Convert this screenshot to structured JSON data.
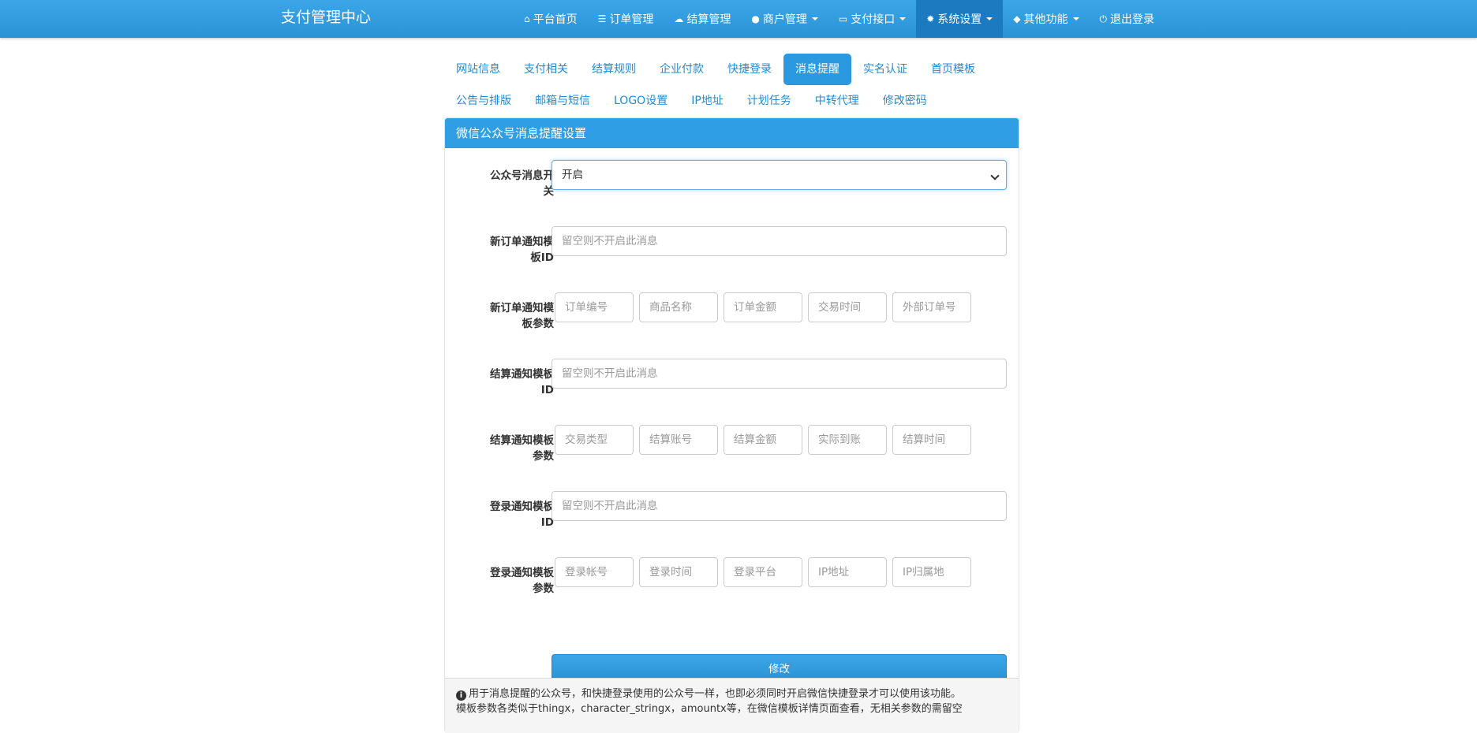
{
  "app": {
    "title": "支付管理中心"
  },
  "nav": [
    {
      "label": "平台首页",
      "icon": "home-icon"
    },
    {
      "label": "订单管理",
      "icon": "list-icon"
    },
    {
      "label": "结算管理",
      "icon": "cloud-icon"
    },
    {
      "label": "商户管理",
      "icon": "user-icon",
      "dropdown": true
    },
    {
      "label": "支付接口",
      "icon": "credit-card-icon",
      "dropdown": true
    },
    {
      "label": "系统设置",
      "icon": "gear-icon",
      "dropdown": true,
      "active": true
    },
    {
      "label": "其他功能",
      "icon": "cube-icon",
      "dropdown": true
    },
    {
      "label": "退出登录",
      "icon": "power-icon"
    }
  ],
  "tabs": {
    "row1": [
      "网站信息",
      "支付相关",
      "结算规则",
      "企业付款",
      "快捷登录",
      "消息提醒",
      "实名认证",
      "首页模板"
    ],
    "row2": [
      "公告与排版",
      "邮箱与短信",
      "LOGO设置",
      "IP地址",
      "计划任务",
      "中转代理",
      "修改密码"
    ],
    "active": "消息提醒"
  },
  "panel": {
    "title": "微信公众号消息提醒设置",
    "switch": {
      "label_line1": "公众号消息开",
      "label_line2": "关",
      "value": "开启"
    },
    "order_tpl": {
      "label_line1": "新订单通知模",
      "label_line2": "板ID",
      "placeholder": "留空则不开启此消息"
    },
    "order_params": {
      "label_line1": "新订单通知模",
      "label_line2": "板参数",
      "items": [
        "订单编号",
        "商品名称",
        "订单金额",
        "交易时间",
        "外部订单号"
      ]
    },
    "settle_tpl": {
      "label_line1": "结算通知模板",
      "label_line2": "ID",
      "placeholder": "留空则不开启此消息"
    },
    "settle_params": {
      "label_line1": "结算通知模板",
      "label_line2": "参数",
      "items": [
        "交易类型",
        "结算账号",
        "结算金额",
        "实际到账",
        "结算时间"
      ]
    },
    "login_tpl": {
      "label_line1": "登录通知模板",
      "label_line2": "ID",
      "placeholder": "留空则不开启此消息"
    },
    "login_params": {
      "label_line1": "登录通知模板",
      "label_line2": "参数",
      "items": [
        "登录帐号",
        "登录时间",
        "登录平台",
        "IP地址",
        "IP归属地"
      ]
    },
    "submit_label": "修改",
    "note_line1": "用于消息提醒的公众号，和快捷登录使用的公众号一样，也即必须同时开启微信快捷登录才可以使用该功能。",
    "note_line2": "模板参数各类似于thingx，character_stringx，amountx等，在微信模板详情页面查看，无相关参数的需留空"
  }
}
